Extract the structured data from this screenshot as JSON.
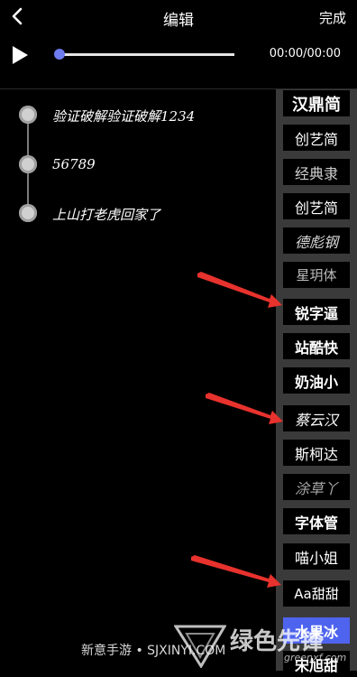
{
  "header": {
    "title": "编辑",
    "done_label": "完成",
    "back_icon": "chevron-left-icon"
  },
  "player": {
    "play_icon": "play-icon",
    "progress": 0,
    "time": "00:00/00:00",
    "accent": "#6e7cf0"
  },
  "lyrics": [
    {
      "text": "验证破解验证破解1234"
    },
    {
      "text": "56789"
    },
    {
      "text": "上山打老虎回家了"
    }
  ],
  "fonts": [
    {
      "label": "汉鼎简",
      "selected": false
    },
    {
      "label": "创艺简",
      "selected": false
    },
    {
      "label": "经典隶",
      "selected": false
    },
    {
      "label": "创艺简",
      "selected": false
    },
    {
      "label": "德彪钢",
      "selected": false
    },
    {
      "label": "星玥体",
      "selected": false
    },
    {
      "label": "锐字逼",
      "selected": false
    },
    {
      "label": "站酷快",
      "selected": false
    },
    {
      "label": "奶油小",
      "selected": false
    },
    {
      "label": "蔡云汉",
      "selected": false
    },
    {
      "label": "斯柯达",
      "selected": false
    },
    {
      "label": "涂草丫",
      "selected": false
    },
    {
      "label": "字体管",
      "selected": false
    },
    {
      "label": "喵小姐",
      "selected": false
    },
    {
      "label": "Aa甜甜",
      "selected": false
    },
    {
      "label": "水果冰",
      "selected": true
    },
    {
      "label": "宋旭甜",
      "selected": false
    }
  ],
  "watermark": {
    "left": "新意手游 • SJXINYI.COM",
    "right": "绿色先锋",
    "url": "greenxf.com"
  },
  "colors": {
    "selected_bg": "#4f64ee",
    "arrow": "#e8322d",
    "panel": "#3a3a3a"
  }
}
